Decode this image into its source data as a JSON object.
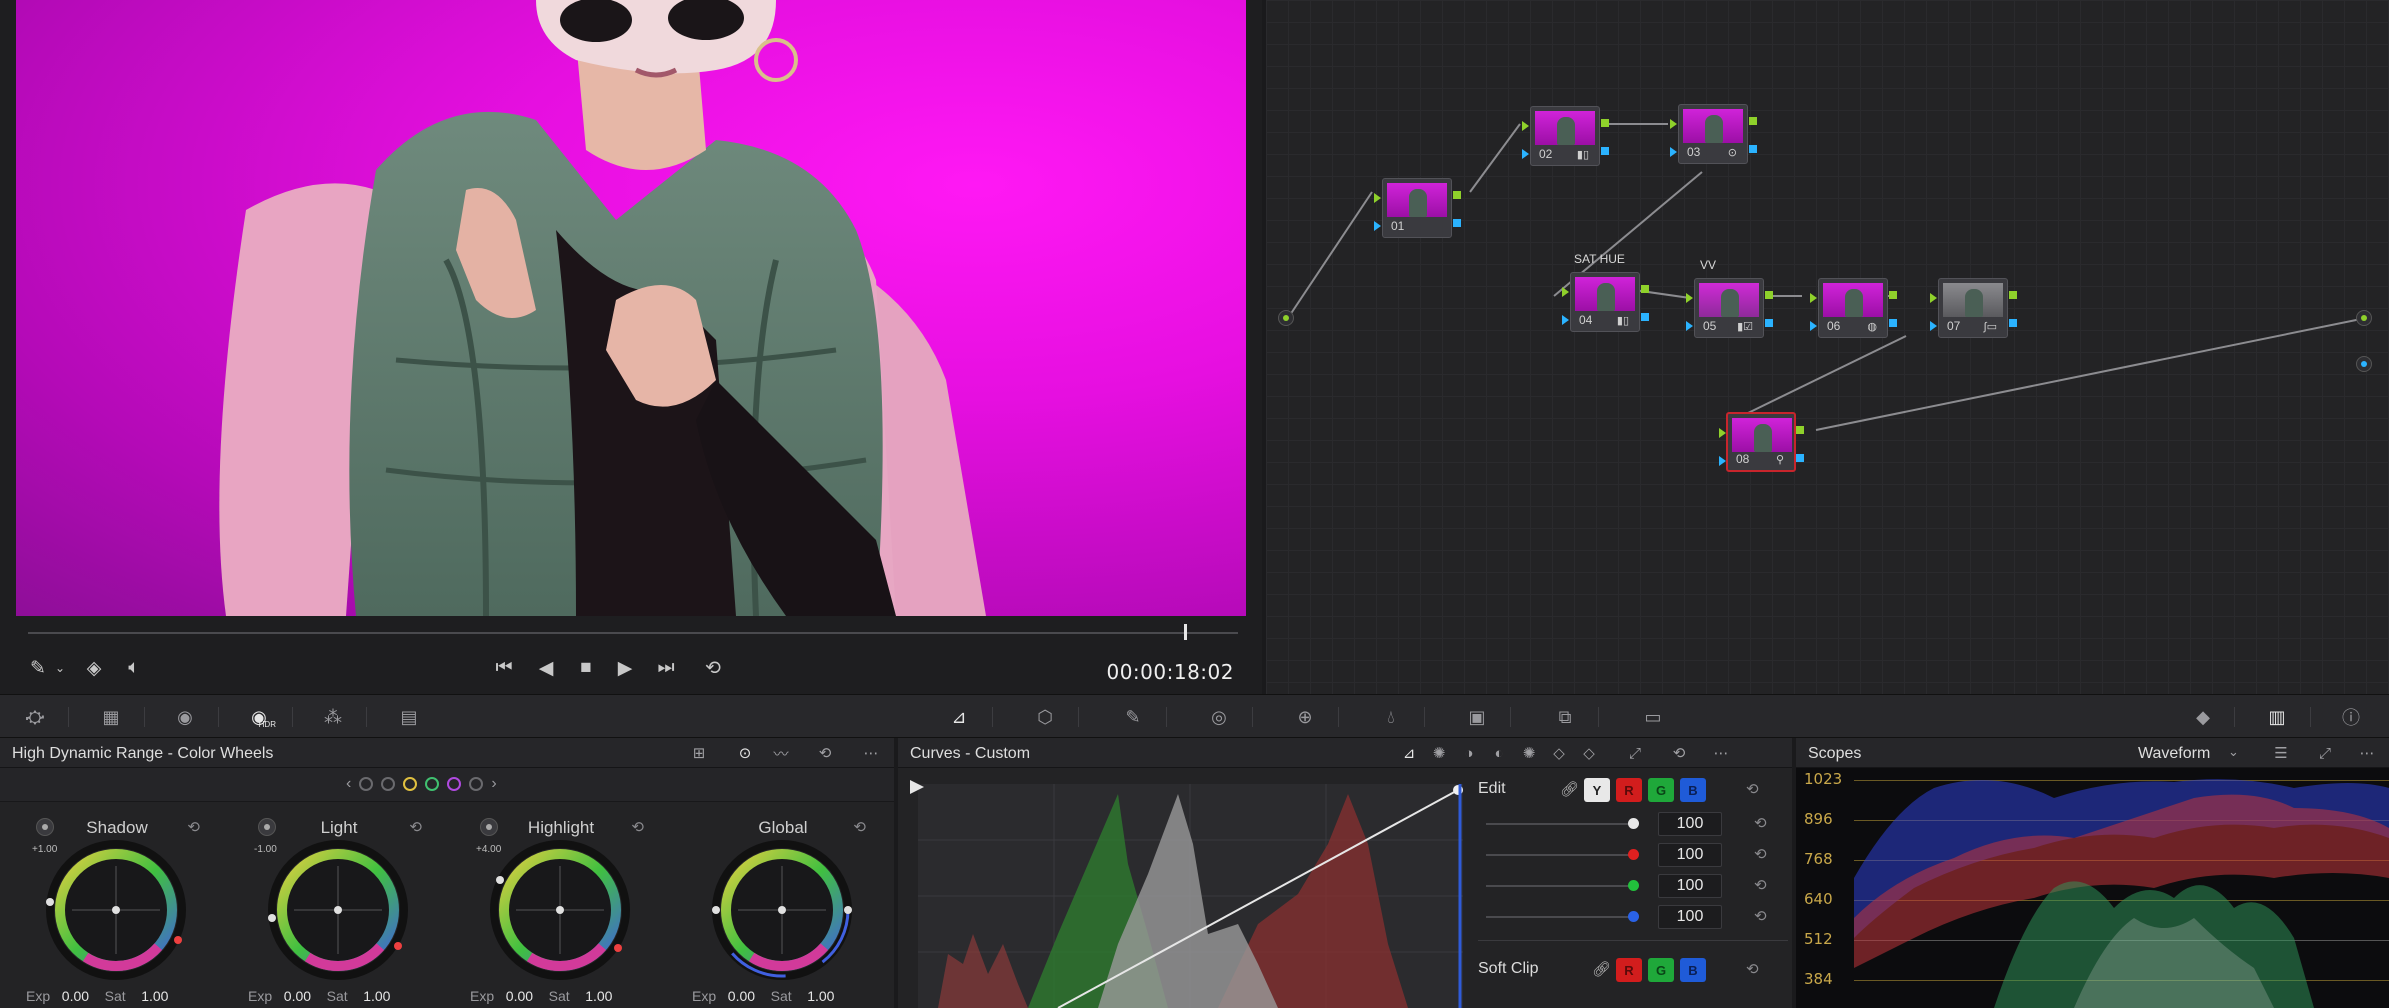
{
  "viewer": {
    "timecode": "00:00:18:02",
    "playhead_fraction": 0.955
  },
  "nodes": [
    {
      "label": "01",
      "icon": ""
    },
    {
      "label": "02",
      "icon": "bars-icon"
    },
    {
      "label": "03",
      "icon": "circle-icon"
    },
    {
      "label": "04",
      "icon": "bars-icon",
      "title": "SAT HUE"
    },
    {
      "label": "05",
      "icon": "bars-check-icon",
      "title": "VV"
    },
    {
      "label": "06",
      "icon": "globe-icon"
    },
    {
      "label": "07",
      "icon": "curve-window-icon"
    },
    {
      "label": "08",
      "icon": "magic-icon",
      "selected": true
    }
  ],
  "node_titles": {
    "n04": "SAT HUE",
    "n05": "VV"
  },
  "wheels_panel": {
    "title": "High Dynamic Range - Color Wheels",
    "hdr_badge": "HDR",
    "wheels": [
      {
        "name": "Shadow",
        "value": "+1.00",
        "exp_label": "Exp",
        "exp": "0.00",
        "sat_label": "Sat",
        "sat": "1.00"
      },
      {
        "name": "Light",
        "value": "-1.00",
        "exp_label": "Exp",
        "exp": "0.00",
        "sat_label": "Sat",
        "sat": "1.00"
      },
      {
        "name": "Highlight",
        "value": "+4.00",
        "exp_label": "Exp",
        "exp": "0.00",
        "sat_label": "Sat",
        "sat": "1.00"
      },
      {
        "name": "Global",
        "value": "",
        "exp_label": "Exp",
        "exp": "0.00",
        "sat_label": "Sat",
        "sat": "1.00"
      }
    ]
  },
  "curves_panel": {
    "title": "Curves - Custom",
    "edit_label": "Edit",
    "soft_clip_label": "Soft Clip",
    "channel_chips": [
      "Y",
      "R",
      "G",
      "B"
    ],
    "soft_clip_chips": [
      "R",
      "G",
      "B"
    ],
    "sliders": [
      {
        "channel": "Y",
        "value": "100",
        "color": "#e8e8e8"
      },
      {
        "channel": "R",
        "value": "100",
        "color": "#e02020"
      },
      {
        "channel": "G",
        "value": "100",
        "color": "#22c03c"
      },
      {
        "channel": "B",
        "value": "100",
        "color": "#2a62e6"
      }
    ]
  },
  "scopes_panel": {
    "title": "Scopes",
    "mode": "Waveform",
    "ticks": [
      "1023",
      "896",
      "768",
      "640",
      "512",
      "384"
    ]
  },
  "colors": {
    "accent_red": "#c8252c",
    "node_green": "#8fd12b",
    "node_blue": "#2bb3ff",
    "scope_gold": "#c9a84a"
  }
}
